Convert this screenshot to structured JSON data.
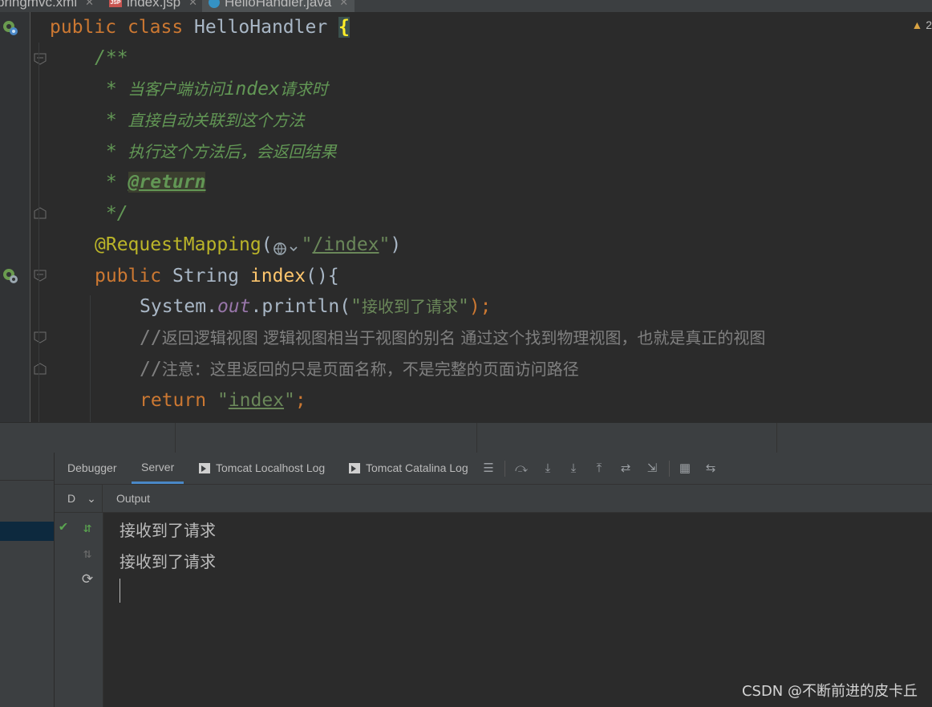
{
  "tabs": [
    {
      "label": "pringmvc.xml"
    },
    {
      "label": "index.jsp",
      "icon": "JSP"
    },
    {
      "label": "HelloHandler.java"
    }
  ],
  "warning_count": "2",
  "code": {
    "l1": {
      "kw1": "public ",
      "kw2": "class ",
      "name": "HelloHandler ",
      "brace": "{"
    },
    "l2": "/**",
    "l3": {
      "star": " * ",
      "text": "当客户端访问",
      "mono": "index",
      "tail": "请求时"
    },
    "l4": {
      "star": " * ",
      "text": "直接自动关联到这个方法"
    },
    "l5": {
      "star": " * ",
      "text": "执行这个方法后，会返回结果"
    },
    "l6": {
      "star": " * ",
      "tag": "@return"
    },
    "l7": " */",
    "l8": {
      "ann": "@RequestMapping",
      "open": "(",
      "q1": "\"",
      "path": "/index",
      "q2": "\"",
      "close": ")"
    },
    "l9": {
      "kw": "public ",
      "type": "String ",
      "name": "index",
      "rest": "(){"
    },
    "l10": {
      "cls": "System.",
      "field": "out",
      "call": ".println(",
      "q1": "\"",
      "str": "接收到了请求",
      "q2": "\"",
      "end": ");"
    },
    "l11": {
      "slash": "//",
      "text": "返回逻辑视图 逻辑视图相当于视图的别名 通过这个找到物理视图，也就是真正的视图"
    },
    "l12": {
      "slash": "//",
      "text": "注意：这里返回的只是页面名称，不是完整的页面访问路径"
    },
    "l13": {
      "kw": "return ",
      "q1": "\"",
      "str": "index",
      "q2": "\"",
      "end": ";"
    }
  },
  "panel_tabs": {
    "debugger": "Debugger",
    "server": "Server",
    "localhost_log": "Tomcat Localhost Log",
    "catalina_log": "Tomcat Catalina Log"
  },
  "subbar": {
    "dropdown": "D",
    "output_label": "Output"
  },
  "output_lines": [
    "接收到了请求",
    "接收到了请求"
  ],
  "watermark": "CSDN @不断前进的皮卡丘",
  "colors": {
    "keyword": "#cc7832",
    "method": "#ffc66d",
    "annotation": "#bbb529",
    "string": "#6a8759",
    "doc": "#629755",
    "comment": "#808080",
    "accent": "#4a88c7"
  }
}
